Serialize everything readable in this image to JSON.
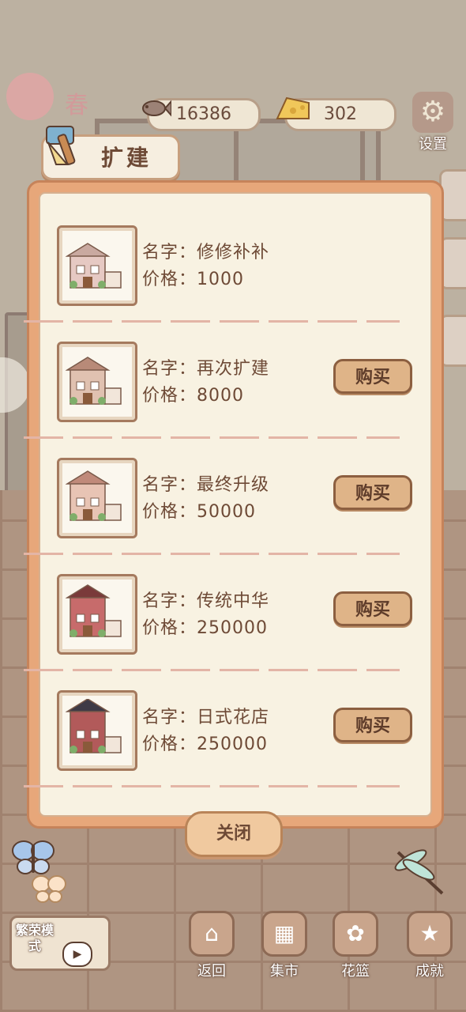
{
  "hud": {
    "season": "春",
    "fish_count": "16386",
    "cheese_count": "302",
    "settings_label": "设置"
  },
  "panel": {
    "title": "扩建",
    "name_prefix": "名字：",
    "price_prefix": "价格：",
    "buy_label": "购买",
    "close_label": "关闭",
    "items": [
      {
        "name": "修修补补",
        "price": "1000",
        "buyable": false
      },
      {
        "name": "再次扩建",
        "price": "8000",
        "buyable": true
      },
      {
        "name": "最终升级",
        "price": "50000",
        "buyable": true
      },
      {
        "name": "传统中华",
        "price": "250000",
        "buyable": true
      },
      {
        "name": "日式花店",
        "price": "250000",
        "buyable": true
      }
    ]
  },
  "bottom": {
    "mode_label": "繁荣模式",
    "back_label": "返回",
    "market_label": "集市",
    "basket_label": "花篮",
    "achievement_label": "成就"
  },
  "colors": {
    "panel_border": "#e7a77a",
    "panel_bg": "#f8f2e2",
    "text": "#6e4a36",
    "buy_button": "#dfb488"
  }
}
